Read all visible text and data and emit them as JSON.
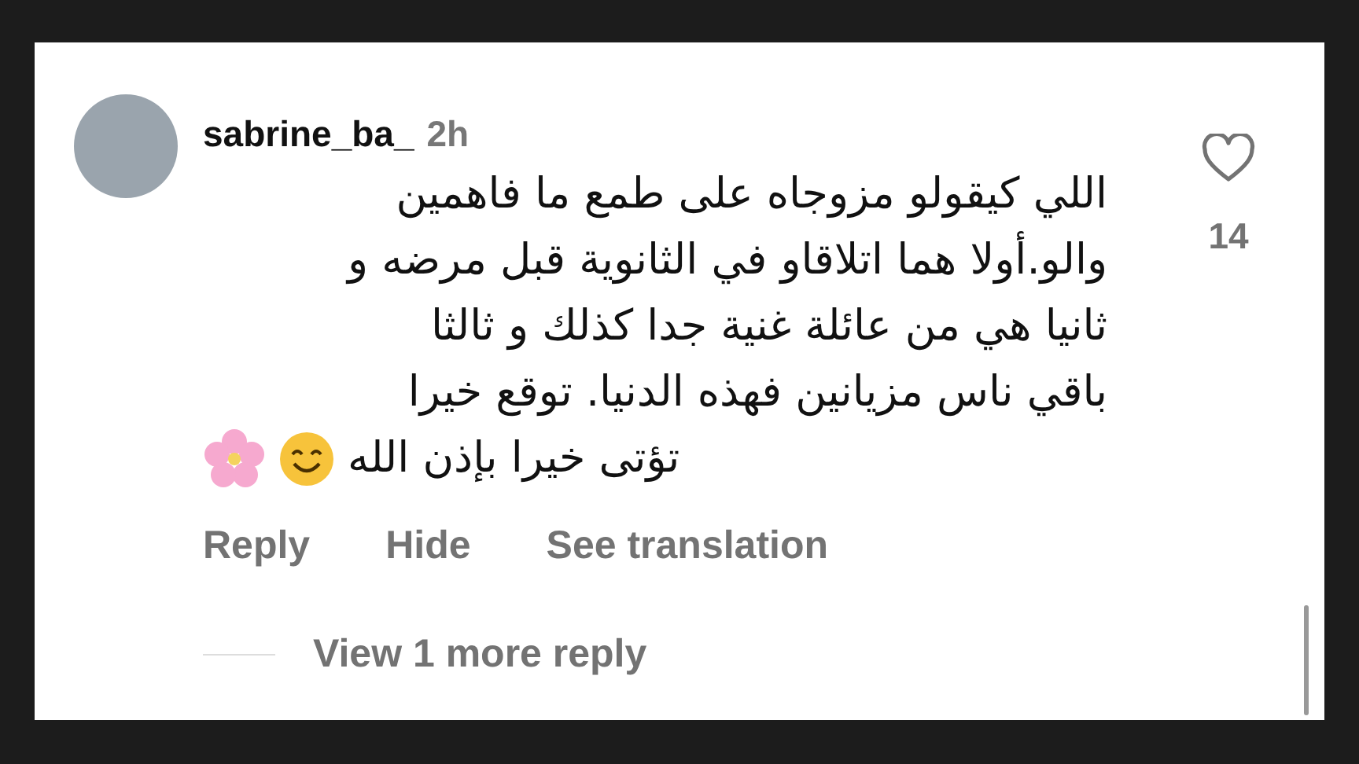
{
  "comment": {
    "username": "sabrine_ba_",
    "time": "2h",
    "text_lines": [
      "اللي كيقولو مزوجاه على طمع ما فاهمين",
      "والو.أولا هما اتلاقاو في الثانوية قبل مرضه و",
      "ثانيا هي من عائلة غنية جدا كذلك و ثالثا",
      "باقي ناس مزيانين فهذه الدنيا. توقع خيرا"
    ],
    "last_line": "تؤتى خيرا بإذن الله",
    "liked": false,
    "like_count": "14",
    "reply_action": "Reply",
    "hide_action": "Hide",
    "translate_action": "See translation",
    "view_replies": "View 1 more reply"
  }
}
